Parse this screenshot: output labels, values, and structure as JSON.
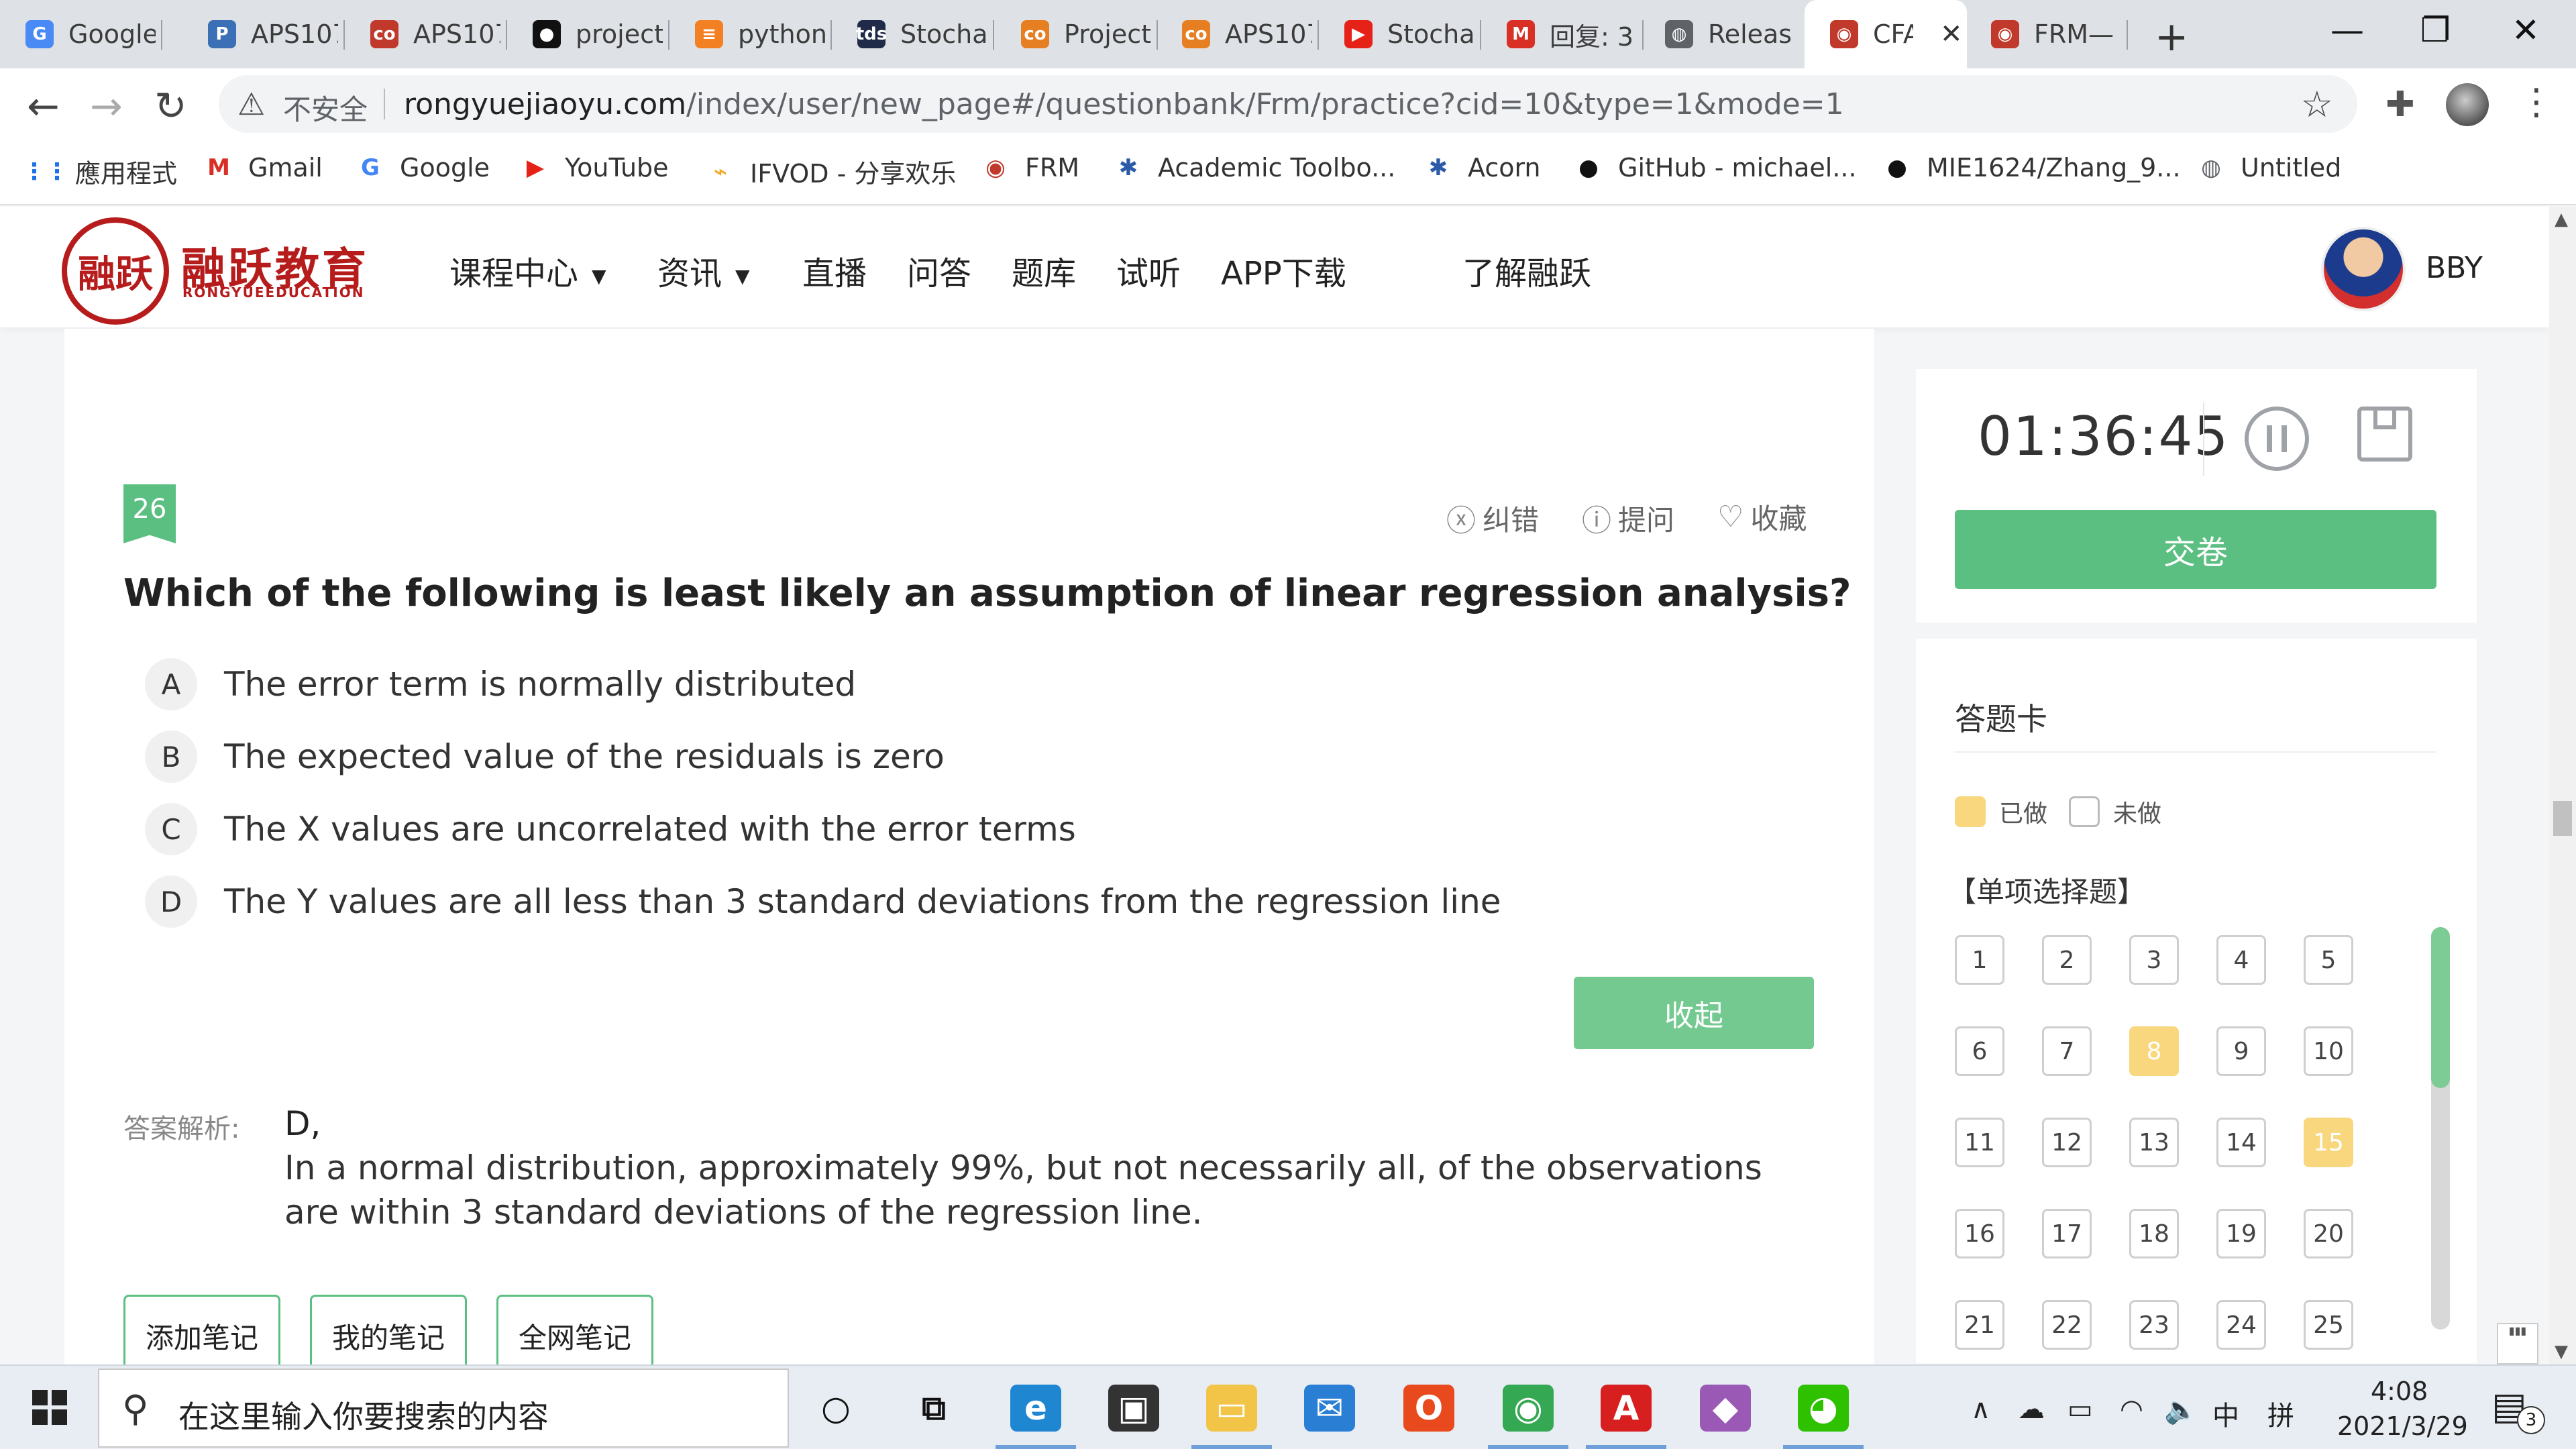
{
  "browser": {
    "tabs": [
      {
        "title": "Google",
        "icon": "google-translate-icon",
        "color": "#4a8af4",
        "glyph": "G"
      },
      {
        "title": "APS107",
        "icon": "p-logo-icon",
        "color": "#3b6fb6",
        "glyph": "P"
      },
      {
        "title": "APS107",
        "icon": "co-logo-icon",
        "color": "#c0392b",
        "glyph": "co"
      },
      {
        "title": "project",
        "icon": "github-icon",
        "color": "#111111",
        "glyph": "●"
      },
      {
        "title": "python",
        "icon": "stackoverflow-icon",
        "color": "#f48024",
        "glyph": "≡"
      },
      {
        "title": "Stocha",
        "icon": "tds-icon",
        "color": "#1f2b49",
        "glyph": "tds"
      },
      {
        "title": "Project",
        "icon": "co-logo-icon",
        "color": "#e67e22",
        "glyph": "co"
      },
      {
        "title": "APS107",
        "icon": "co-logo-icon",
        "color": "#e67e22",
        "glyph": "co"
      },
      {
        "title": "Stocha",
        "icon": "youtube-icon",
        "color": "#e62117",
        "glyph": "▶"
      },
      {
        "title": "回复: 3",
        "icon": "gmail-icon",
        "color": "#d93025",
        "glyph": "M"
      },
      {
        "title": "Releas",
        "icon": "globe-icon",
        "color": "#5f6368",
        "glyph": "◍"
      },
      {
        "title": "CFA",
        "icon": "rongyue-icon",
        "color": "#c0392b",
        "glyph": "◉"
      },
      {
        "title": "FRM—",
        "icon": "rongyue-icon",
        "color": "#c0392b",
        "glyph": "◉"
      }
    ],
    "new_tab": "+",
    "window_controls": {
      "minimize": "—",
      "restore": "❐",
      "close": "✕"
    },
    "insecure_label": "不安全",
    "url_domain": "rongyuejiaoyu.com",
    "url_path": "/index/user/new_page#/questionbank/Frm/practice?cid=10&type=1&mode=1",
    "bookmarks": [
      {
        "label": "應用程式",
        "icon": "apps-grid-icon",
        "color": "#1a73e8",
        "glyph": "⋮⋮"
      },
      {
        "label": "Gmail",
        "icon": "gmail-icon",
        "color": "#d93025",
        "glyph": "M"
      },
      {
        "label": "Google",
        "icon": "google-icon",
        "color": "#4285f4",
        "glyph": "G"
      },
      {
        "label": "YouTube",
        "icon": "youtube-icon",
        "color": "#e62117",
        "glyph": "▶"
      },
      {
        "label": "IFVOD - 分享欢乐",
        "icon": "ifvod-icon",
        "color": "#f5a623",
        "glyph": "⌁"
      },
      {
        "label": "FRM",
        "icon": "rongyue-icon",
        "color": "#c0392b",
        "glyph": "◉"
      },
      {
        "label": "Academic Toolbo...",
        "icon": "academic-tree-icon",
        "color": "#2b5aa8",
        "glyph": "✱"
      },
      {
        "label": "Acorn",
        "icon": "academic-tree-icon",
        "color": "#2b5aa8",
        "glyph": "✱"
      },
      {
        "label": "GitHub - michael...",
        "icon": "github-icon",
        "color": "#111111",
        "glyph": "●"
      },
      {
        "label": "MIE1624/Zhang_9...",
        "icon": "github-icon",
        "color": "#111111",
        "glyph": "●"
      },
      {
        "label": "Untitled",
        "icon": "globe-icon",
        "color": "#5f6368",
        "glyph": "◍"
      }
    ]
  },
  "site": {
    "logo_seal": "融跃",
    "logo_text": "融跃教育",
    "logo_sub": "RONGYUEEDUCATION",
    "nav": [
      "课程中心",
      "资讯",
      "直播",
      "问答",
      "题库",
      "试听",
      "APP下载",
      "了解融跃"
    ],
    "user_name": "BBY",
    "brand_red": "#b71c1c",
    "accent_green": "#5cbf82"
  },
  "question": {
    "number": "26",
    "tools": [
      "纠错",
      "提问",
      "收藏"
    ],
    "title": "Which of the following is least likely an assumption of linear regression analysis?",
    "options": [
      {
        "letter": "A",
        "text": "The error term is normally distributed"
      },
      {
        "letter": "B",
        "text": "The expected value of the residuals is zero"
      },
      {
        "letter": "C",
        "text": "The X values are uncorrelated with the error terms"
      },
      {
        "letter": "D",
        "text": "The Y values are all less than 3 standard deviations from the regression line"
      }
    ],
    "collapse_label": "收起",
    "answer_label": "答案解析:",
    "answer_key": "D,",
    "explanation": "In a normal distribution, approximately 99%, but not necessarily all, of the observations are within 3 standard deviations of the regression line.",
    "note_buttons": [
      "添加笔记",
      "我的笔记",
      "全网笔记"
    ]
  },
  "timer": {
    "time": "01:36:45",
    "submit_label": "交卷"
  },
  "answer_card": {
    "title": "答题卡",
    "legend_done": "已做",
    "legend_todo": "未做",
    "done_color": "#f9d77e",
    "section": "【单项选择题】",
    "numbers": [
      "1",
      "2",
      "3",
      "4",
      "5",
      "6",
      "7",
      "8",
      "9",
      "10",
      "11",
      "12",
      "13",
      "14",
      "15",
      "16",
      "17",
      "18",
      "19",
      "20",
      "21",
      "22",
      "23",
      "24",
      "25"
    ],
    "done": [
      "8",
      "15"
    ]
  },
  "taskbar": {
    "search_placeholder": "在这里输入你要搜索的内容",
    "ime_lang": "中",
    "ime_mode": "拼",
    "time": "4:08",
    "date": "2021/3/29",
    "notification_count": "3",
    "apps": [
      {
        "icon": "cortana-icon",
        "glyph": "○",
        "color": "#111111",
        "bg": "transparent"
      },
      {
        "icon": "task-view-icon",
        "glyph": "⧉",
        "color": "#111111",
        "bg": "transparent"
      },
      {
        "icon": "edge-icon",
        "glyph": "e",
        "color": "#ffffff",
        "bg": "#1f86d1"
      },
      {
        "icon": "store-icon",
        "glyph": "▣",
        "color": "#ffffff",
        "bg": "#333333"
      },
      {
        "icon": "file-explorer-icon",
        "glyph": "▭",
        "color": "#ffffff",
        "bg": "#f2c447"
      },
      {
        "icon": "mail-icon",
        "glyph": "✉",
        "color": "#ffffff",
        "bg": "#2a7fd4"
      },
      {
        "icon": "office-icon",
        "glyph": "O",
        "color": "#ffffff",
        "bg": "#e8491d"
      },
      {
        "icon": "chrome-icon",
        "glyph": "◉",
        "color": "#ffffff",
        "bg": "#34a853"
      },
      {
        "icon": "acrobat-icon",
        "glyph": "A",
        "color": "#ffffff",
        "bg": "#d71f1f"
      },
      {
        "icon": "git-icon",
        "glyph": "◆",
        "color": "#ffffff",
        "bg": "#9b59b6"
      },
      {
        "icon": "wechat-icon",
        "glyph": "◕",
        "color": "#ffffff",
        "bg": "#2dc100"
      }
    ]
  }
}
